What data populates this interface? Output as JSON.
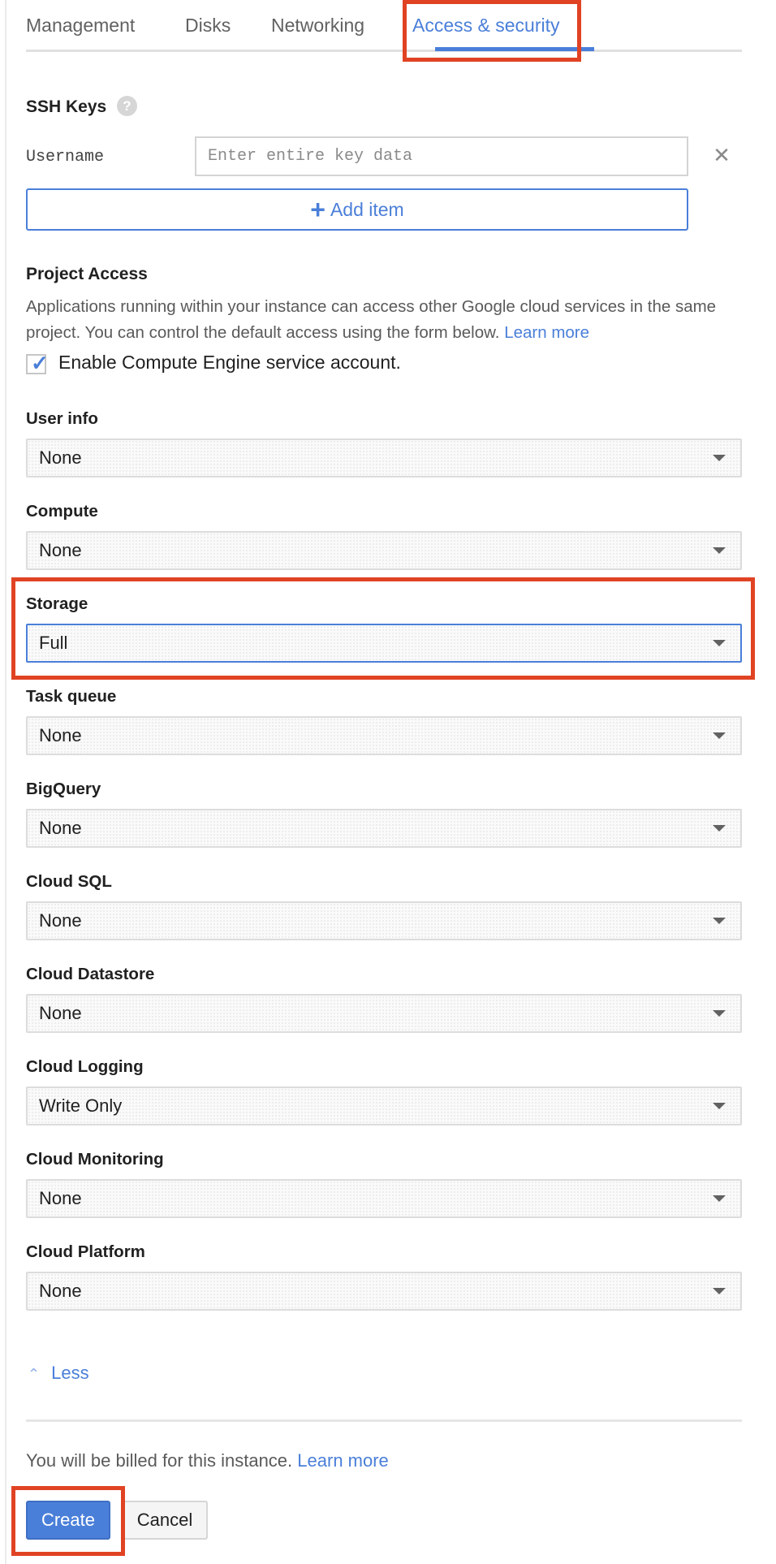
{
  "tabs": [
    {
      "label": "Management"
    },
    {
      "label": "Disks"
    },
    {
      "label": "Networking"
    },
    {
      "label": "Access & security",
      "active": true
    }
  ],
  "ssh": {
    "title": "SSH Keys",
    "help_icon": "?",
    "username_label": "Username",
    "key_placeholder": "Enter entire key data",
    "remove_icon": "✕",
    "add_item_icon": "+",
    "add_item_label": "Add item"
  },
  "project_access": {
    "title": "Project Access",
    "description": "Applications running within your instance can access other Google cloud services in the same project. You can control the default access using the form below.",
    "learn_more": "Learn more",
    "service_account_checked": true,
    "service_account_label": "Enable Compute Engine service account."
  },
  "scopes": [
    {
      "label": "User info",
      "value": "None"
    },
    {
      "label": "Compute",
      "value": "None"
    },
    {
      "label": "Storage",
      "value": "Full",
      "focused": true
    },
    {
      "label": "Task queue",
      "value": "None"
    },
    {
      "label": "BigQuery",
      "value": "None"
    },
    {
      "label": "Cloud SQL",
      "value": "None"
    },
    {
      "label": "Cloud Datastore",
      "value": "None"
    },
    {
      "label": "Cloud Logging",
      "value": "Write Only"
    },
    {
      "label": "Cloud Monitoring",
      "value": "None"
    },
    {
      "label": "Cloud Platform",
      "value": "None"
    }
  ],
  "less": {
    "icon": "chevron-up-icon",
    "label": "Less"
  },
  "footer": {
    "billing_text": "You will be billed for this instance.",
    "learn_more": "Learn more",
    "create_label": "Create",
    "cancel_label": "Cancel"
  },
  "colors": {
    "accent": "#4a7fd9",
    "highlight": "#e04323"
  }
}
